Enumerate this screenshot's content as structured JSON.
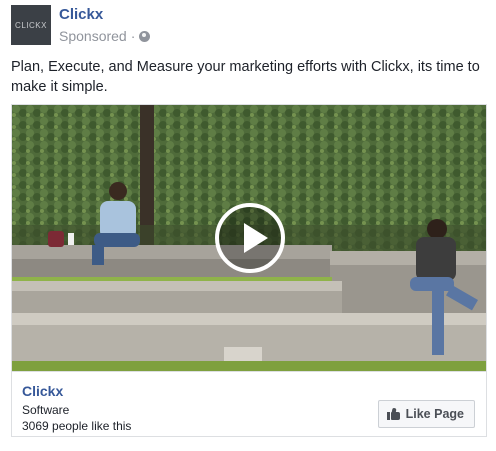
{
  "post": {
    "avatar_text": "CLICKX",
    "page_name": "Clickx",
    "sponsored_label": "Sponsored",
    "separator": "·",
    "privacy_icon": "globe-icon",
    "message": "Plan, Execute, and Measure your marketing efforts with Clickx, its time to make it simple."
  },
  "card": {
    "video_icon": "play-icon",
    "title": "Clickx",
    "category": "Software",
    "likes_text": "3069 people like this",
    "like_button_label": "Like Page",
    "like_button_icon": "thumbs-up-icon"
  },
  "colors": {
    "link_blue": "#365899",
    "muted_text": "#90949c",
    "body_text": "#1d2129",
    "border": "#dddfe2"
  }
}
